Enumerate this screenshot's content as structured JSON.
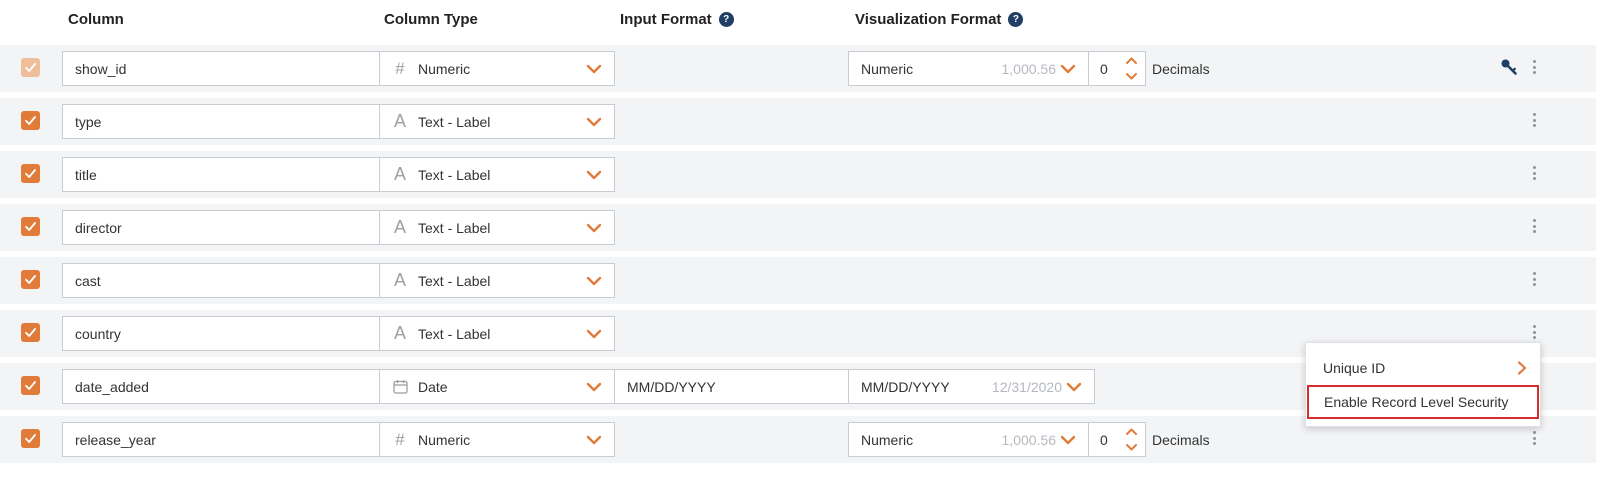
{
  "header": {
    "column": "Column",
    "column_type": "Column Type",
    "input_format": "Input Format",
    "visualization_format": "Visualization Format",
    "help_glyph": "?"
  },
  "rows": [
    {
      "name": "show_id",
      "type": "Numeric",
      "type_icon": "hash-icon",
      "checked": true,
      "disabled": true,
      "vis_format": "Numeric",
      "vis_sample": "1,000.56",
      "decimals": "0",
      "decimals_label": "Decimals",
      "has_key_icon": true
    },
    {
      "name": "type",
      "type": "Text - Label",
      "type_icon": "text-a-icon",
      "checked": true
    },
    {
      "name": "title",
      "type": "Text - Label",
      "type_icon": "text-a-icon",
      "checked": true
    },
    {
      "name": "director",
      "type": "Text - Label",
      "type_icon": "text-a-icon",
      "checked": true
    },
    {
      "name": "cast",
      "type": "Text - Label",
      "type_icon": "text-a-icon",
      "checked": true
    },
    {
      "name": "country",
      "type": "Text - Label",
      "type_icon": "text-a-icon",
      "checked": true
    },
    {
      "name": "date_added",
      "type": "Date",
      "type_icon": "calendar-icon",
      "checked": true,
      "input_format": "MM/DD/YYYY",
      "vis_format": "MM/DD/YYYY",
      "vis_sample": "12/31/2020"
    },
    {
      "name": "release_year",
      "type": "Numeric",
      "type_icon": "hash-icon",
      "checked": true,
      "vis_format": "Numeric",
      "vis_sample": "1,000.56",
      "decimals": "0",
      "decimals_label": "Decimals"
    }
  ],
  "context_menu": {
    "items": [
      {
        "label": "Unique ID",
        "has_submenu": true
      },
      {
        "label": "Enable Record Level Security",
        "highlighted": true
      }
    ]
  },
  "colors": {
    "accent": "#e07b3a",
    "accent_disabled": "#efbf9c",
    "row_bg": "#f3f4f6",
    "help_bg": "#1f3f66",
    "highlight_border": "#d32f2f",
    "key_icon": "#1f3f66"
  }
}
